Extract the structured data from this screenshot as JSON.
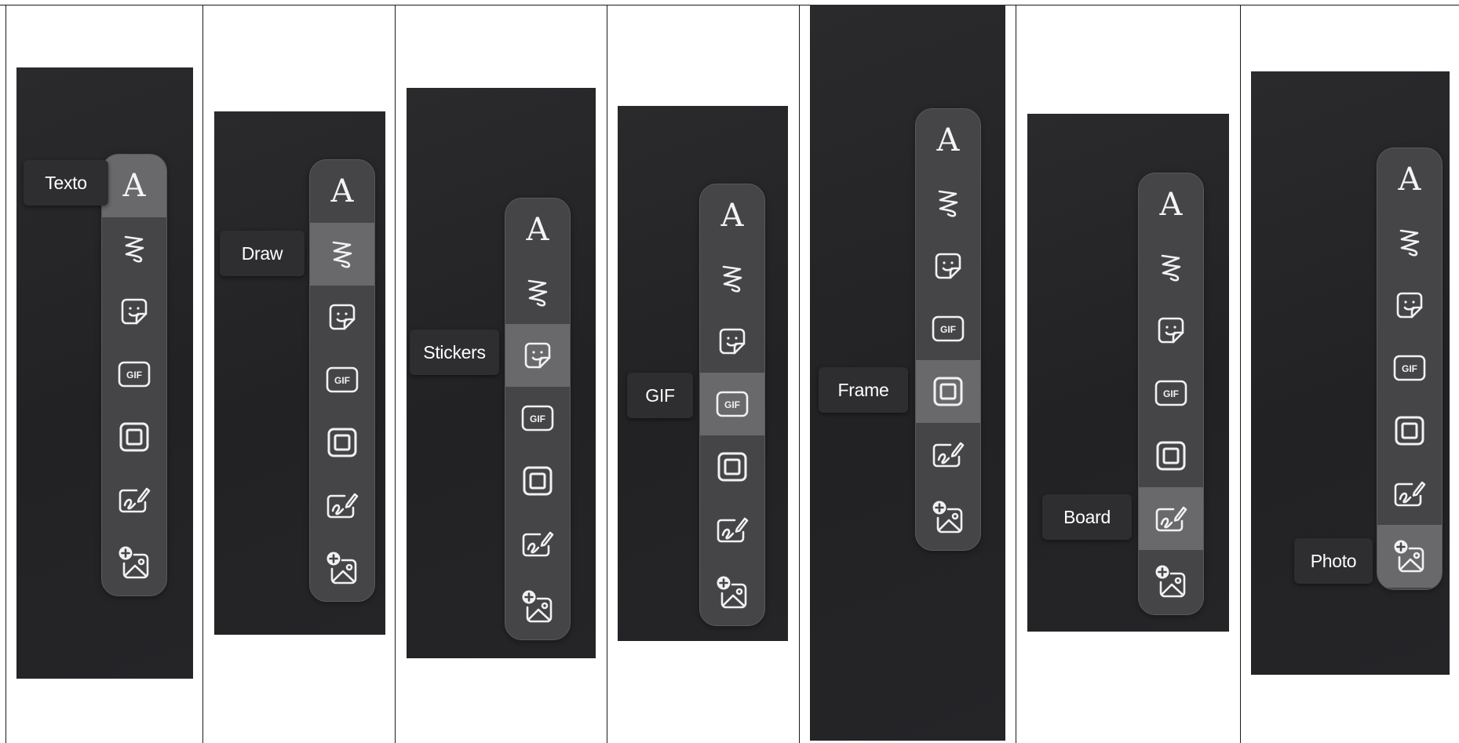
{
  "tools": [
    {
      "id": "text",
      "icon": "text-a-icon",
      "glyph": "A"
    },
    {
      "id": "draw",
      "icon": "squiggle-draw-icon"
    },
    {
      "id": "stickers",
      "icon": "sticker-smile-icon"
    },
    {
      "id": "gif",
      "icon": "gif-icon",
      "glyph": "GIF"
    },
    {
      "id": "frame",
      "icon": "frame-square-icon"
    },
    {
      "id": "board",
      "icon": "board-pen-icon"
    },
    {
      "id": "photo",
      "icon": "add-photo-icon"
    }
  ],
  "variants": [
    {
      "tooltip": "Texto",
      "active_tool": "text"
    },
    {
      "tooltip": "Draw",
      "active_tool": "draw"
    },
    {
      "tooltip": "Stickers",
      "active_tool": "stickers"
    },
    {
      "tooltip": "GIF",
      "active_tool": "gif"
    },
    {
      "tooltip": "Frame",
      "active_tool": "frame"
    },
    {
      "tooltip": "Board",
      "active_tool": "board"
    },
    {
      "tooltip": "Photo",
      "active_tool": "photo"
    }
  ],
  "colors": {
    "page_background": "#ffffff",
    "panel_background": "#252527",
    "toolbar_background": "#454547",
    "active_tool_background": "#69696c",
    "tooltip_background": "#2e2e30",
    "icon_color": "#f1f1f1"
  }
}
